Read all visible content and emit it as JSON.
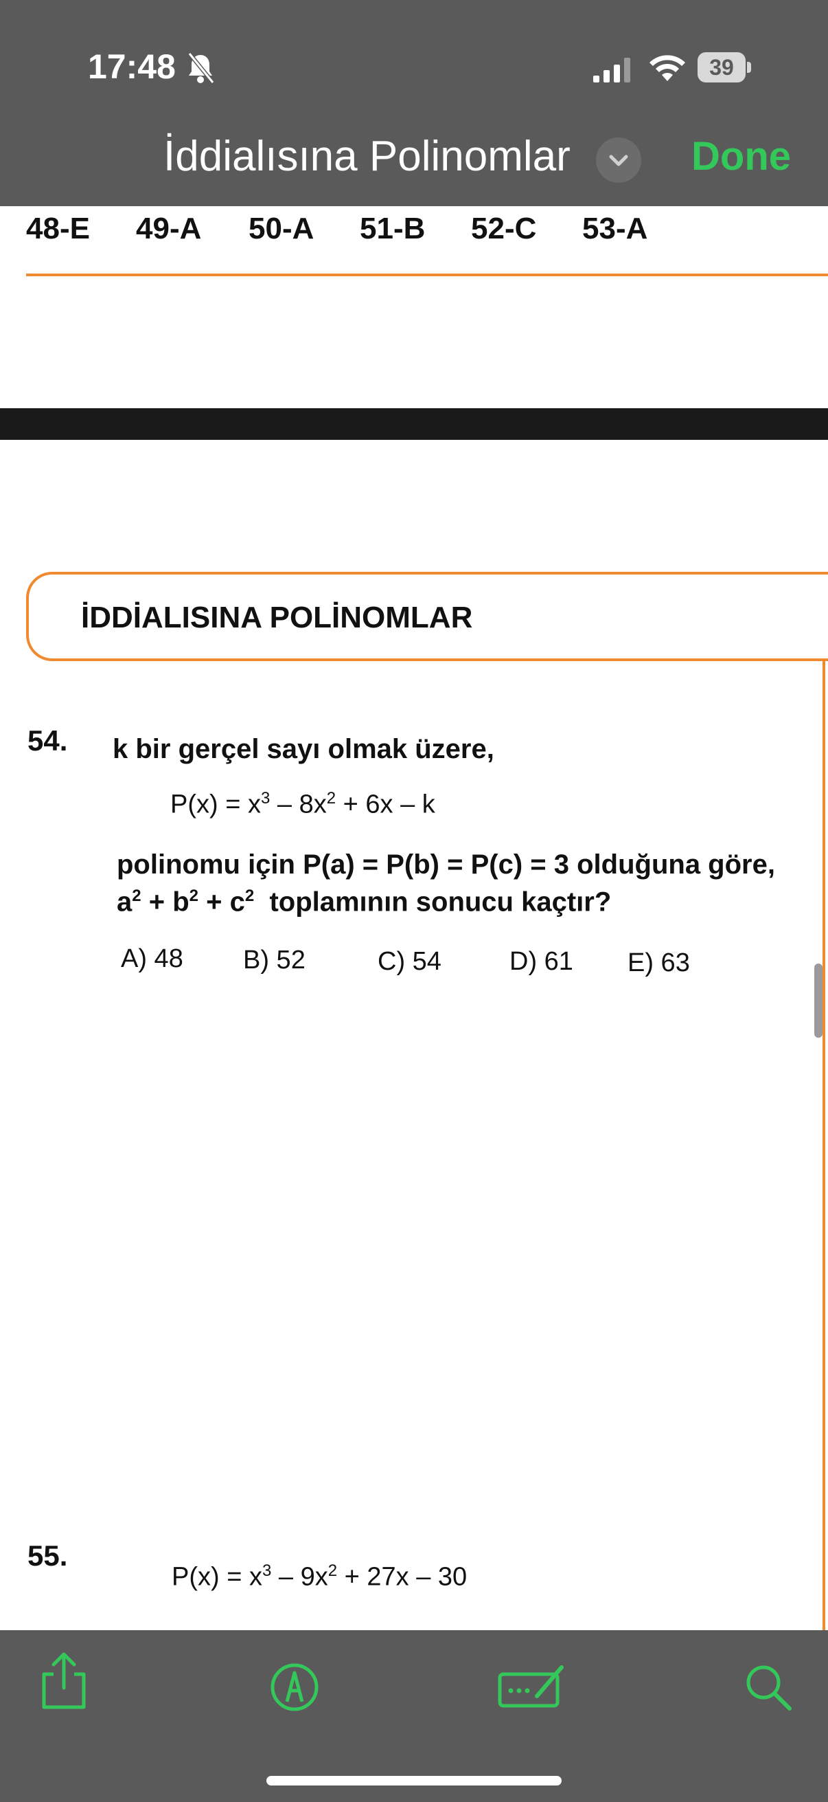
{
  "status_bar": {
    "time": "17:48",
    "battery": "39"
  },
  "nav": {
    "title": "İddialısına Polinomlar",
    "done_label": "Done"
  },
  "answers": [
    "48-E",
    "49-A",
    "50-A",
    "51-B",
    "52-C",
    "53-A"
  ],
  "section_title": "İDDİALISINA POLİNOMLAR",
  "q54": {
    "number": "54.",
    "line1": "k  bir gerçel sayı olmak üzere,",
    "line3": "polinomu için  P(a) = P(b) = P(c) = 3  olduğuna göre,",
    "line4_rest": "toplamının sonucu kaçtır?",
    "options": [
      "A) 48",
      "B) 52",
      "C) 54",
      "D) 61",
      "E) 63"
    ]
  },
  "q55": {
    "number": "55."
  },
  "colors": {
    "accent": "#34c759",
    "orange": "#ef8a30",
    "chrome": "#5a5a5a"
  },
  "toolbar_icons": [
    "share-icon",
    "markup-icon",
    "signature-icon",
    "search-icon"
  ]
}
